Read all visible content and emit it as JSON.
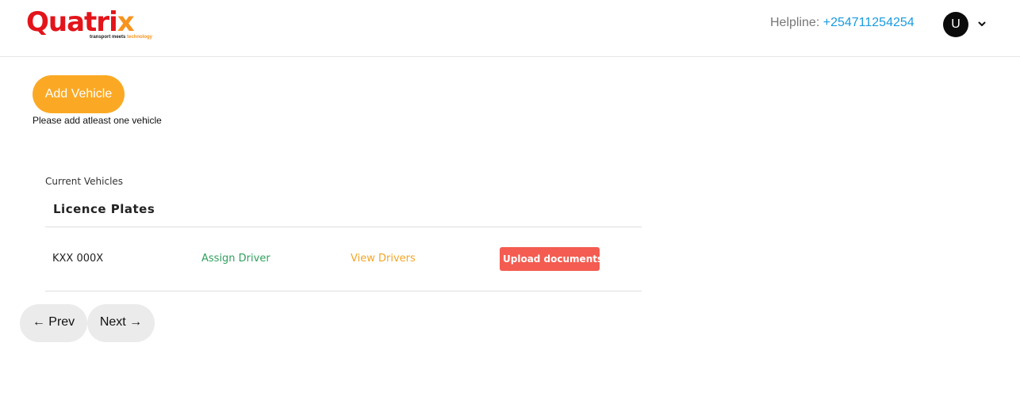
{
  "header": {
    "logo": {
      "word_main": "Quatri",
      "word_x": "x",
      "tagline_main": "transport meets ",
      "tagline_highlight": "technology"
    },
    "helpline_label": "Helpline:",
    "helpline_number": "+254711254254",
    "avatar_initial": "U",
    "avatar_menu_icon": "chevron-down-icon"
  },
  "main": {
    "add_vehicle_label": "Add Vehicle",
    "hint": "Please add atleast one vehicle",
    "section_label": "Current Vehicles",
    "table": {
      "column_header": "Licence Plates",
      "rows": [
        {
          "plate": "KXX 000X",
          "assign_label": "Assign Driver",
          "view_label": "View Drivers",
          "upload_label": "Upload documents"
        }
      ]
    }
  },
  "pagination": {
    "prev_label": "← Prev",
    "next_label": "Next →"
  },
  "colors": {
    "brand_red": "#e3141a",
    "brand_orange": "#f7931e",
    "add_button": "#fba924",
    "assign_link": "#2fa15d",
    "view_link": "#f4a524",
    "upload_button": "#f45c51",
    "helpline_number": "#1a9be0"
  }
}
